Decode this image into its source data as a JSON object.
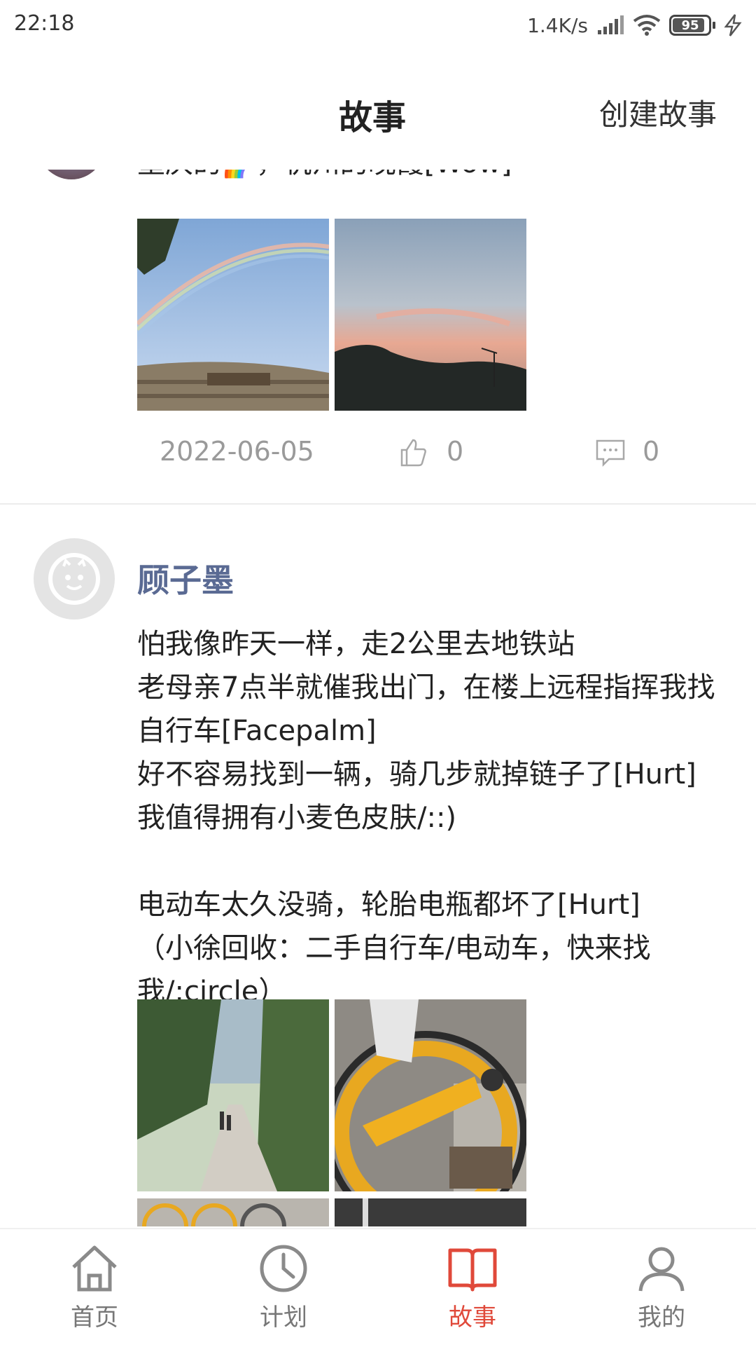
{
  "status_bar": {
    "time": "22:18",
    "net_speed": "1.4K/s",
    "battery": "95"
  },
  "header": {
    "title": "故事",
    "action": "创建故事"
  },
  "posts": [
    {
      "text": "重庆的🌈，杭州的晚霞[Wow]",
      "date": "2022-06-05",
      "likes": "0",
      "comments": "0"
    },
    {
      "author": "顾子墨",
      "text": "怕我像昨天一样，走2公里去地铁站\n老母亲7点半就催我出门，在楼上远程指挥我找自行车[Facepalm]\n好不容易找到一辆，骑几步就掉链子了[Hurt]\n我值得拥有小麦色皮肤/::)\n\n电动车太久没骑，轮胎电瓶都坏了[Hurt]\n（小徐回收：二手自行车/电动车，快来找我/:circle）"
    }
  ],
  "nav": {
    "items": [
      {
        "label": "首页",
        "icon": "home-icon"
      },
      {
        "label": "计划",
        "icon": "clock-icon"
      },
      {
        "label": "故事",
        "icon": "book-icon",
        "active": true
      },
      {
        "label": "我的",
        "icon": "person-icon"
      }
    ]
  },
  "colors": {
    "accent": "#e0493a",
    "username": "#5a6a93"
  }
}
